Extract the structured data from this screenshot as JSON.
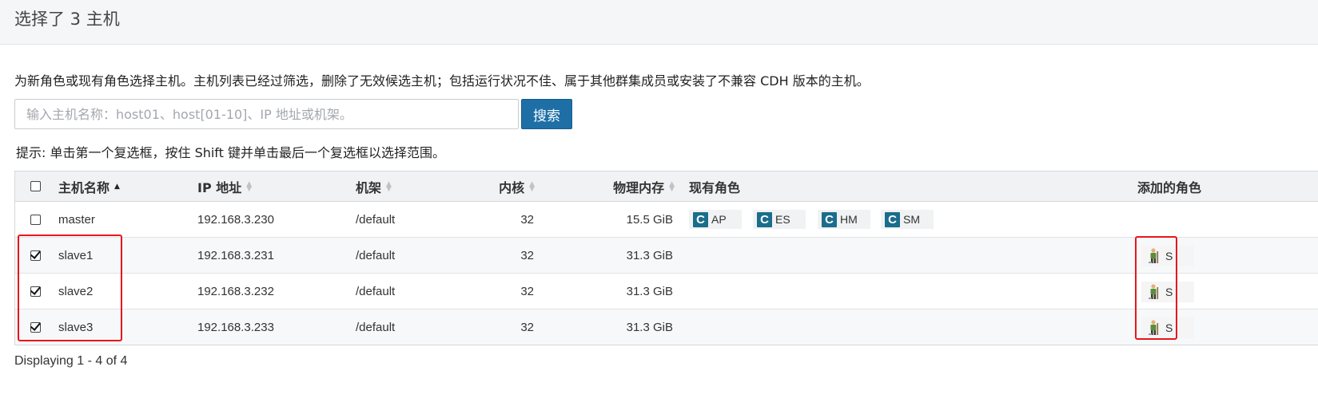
{
  "header": {
    "title": "选择了 3 主机"
  },
  "description": "为新角色或现有角色选择主机。主机列表已经过筛选，删除了无效候选主机；包括运行状况不佳、属于其他群集成员或安装了不兼容 CDH 版本的主机。",
  "search": {
    "placeholder": "输入主机名称：host01、host[01-10]、IP 地址或机架。",
    "value": "",
    "button_label": "搜索"
  },
  "hint": "提示: 单击第一个复选框，按住 Shift 键并单击最后一个复选框以选择范围。",
  "table": {
    "columns": {
      "hostname": "主机名称",
      "ip": "IP 地址",
      "rack": "机架",
      "cores": "内核",
      "memory": "物理内存",
      "existing_roles": "现有角色",
      "added_roles": "添加的角色"
    },
    "select_all_checked": false,
    "rows": [
      {
        "checked": false,
        "hostname": "master",
        "ip": "192.168.3.230",
        "rack": "/default",
        "cores": "32",
        "memory": "15.5 GiB",
        "existing_roles": [
          {
            "icon": "cloudera-c-icon",
            "label": "AP"
          },
          {
            "icon": "cloudera-c-icon",
            "label": "ES"
          },
          {
            "icon": "cloudera-c-icon",
            "label": "HM"
          },
          {
            "icon": "cloudera-c-icon",
            "label": "SM"
          }
        ],
        "added_roles": []
      },
      {
        "checked": true,
        "hostname": "slave1",
        "ip": "192.168.3.231",
        "rack": "/default",
        "cores": "32",
        "memory": "31.3 GiB",
        "existing_roles": [],
        "added_roles": [
          {
            "icon": "worker-icon",
            "label": "S"
          }
        ]
      },
      {
        "checked": true,
        "hostname": "slave2",
        "ip": "192.168.3.232",
        "rack": "/default",
        "cores": "32",
        "memory": "31.3 GiB",
        "existing_roles": [],
        "added_roles": [
          {
            "icon": "worker-icon",
            "label": "S"
          }
        ]
      },
      {
        "checked": true,
        "hostname": "slave3",
        "ip": "192.168.3.233",
        "rack": "/default",
        "cores": "32",
        "memory": "31.3 GiB",
        "existing_roles": [],
        "added_roles": [
          {
            "icon": "worker-icon",
            "label": "S"
          }
        ]
      }
    ]
  },
  "footer": "Displaying 1 - 4 of 4",
  "colors": {
    "primary_button": "#1d6fa6",
    "role_icon": "#1b6d8c",
    "highlight_box": "#e8161b"
  }
}
